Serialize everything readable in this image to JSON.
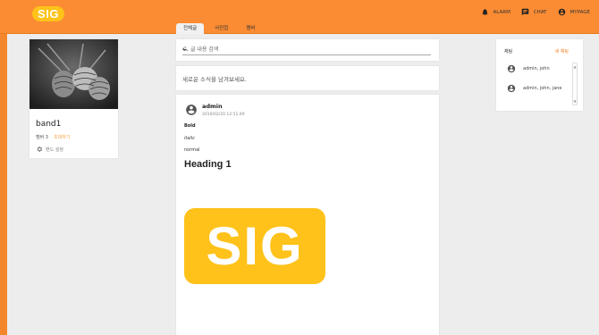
{
  "header": {
    "logo": "SIG",
    "actions": [
      {
        "label": "ALARM",
        "icon": "bell-icon"
      },
      {
        "label": "CHAT",
        "icon": "chat-icon"
      },
      {
        "label": "MYPAGE",
        "icon": "account-icon"
      }
    ],
    "tabs": [
      "전체글",
      "사진첩",
      "멤버"
    ],
    "active_tab": 0
  },
  "band": {
    "name": "band1",
    "members": "멤버 3",
    "invite": "초대하기",
    "settings": "밴드 설정"
  },
  "search": {
    "placeholder": "글 내용 검색"
  },
  "compose": {
    "placeholder": "새로운 소식을 남겨보세요."
  },
  "post": {
    "author": "admin",
    "time": "2019/02/20 12:51:49",
    "bold": "Bold",
    "italic": "italic",
    "normal": "normal",
    "heading": "Heading 1",
    "image_text": "SIG"
  },
  "chat": {
    "title": "채팅",
    "new_chat": "새 채팅",
    "rooms": [
      {
        "name": "admin, john"
      },
      {
        "name": "admin, john, jane"
      }
    ]
  },
  "colors": {
    "header": "#fb8c33",
    "accent": "#f4872b",
    "logo": "#ffc21a"
  }
}
